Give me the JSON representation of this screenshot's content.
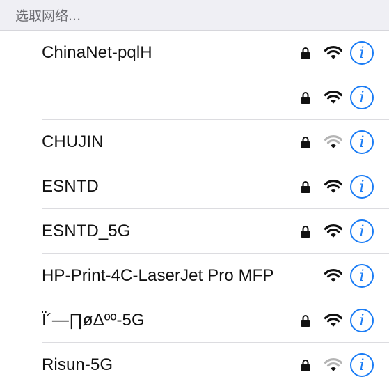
{
  "header": {
    "title": "选取网络..."
  },
  "colors": {
    "accent": "#1a7cf5",
    "wifi_strong": "#111111",
    "wifi_weak": "#b4b4b4"
  },
  "networks": [
    {
      "name": "ChinaNet-pqlH",
      "secured": true,
      "signal": "strong",
      "info_label": "i"
    },
    {
      "name": "",
      "secured": true,
      "signal": "strong",
      "info_label": "i"
    },
    {
      "name": "CHUJIN",
      "secured": true,
      "signal": "weak",
      "info_label": "i"
    },
    {
      "name": "ESNTD",
      "secured": true,
      "signal": "strong",
      "info_label": "i"
    },
    {
      "name": "ESNTD_5G",
      "secured": true,
      "signal": "strong",
      "info_label": "i"
    },
    {
      "name": "HP-Print-4C-LaserJet Pro MFP",
      "secured": false,
      "signal": "strong",
      "info_label": "i"
    },
    {
      "name": "Ï´—∏øΔºº-5G",
      "secured": true,
      "signal": "strong",
      "info_label": "i"
    },
    {
      "name": "Risun-5G",
      "secured": true,
      "signal": "weak",
      "info_label": "i"
    }
  ]
}
